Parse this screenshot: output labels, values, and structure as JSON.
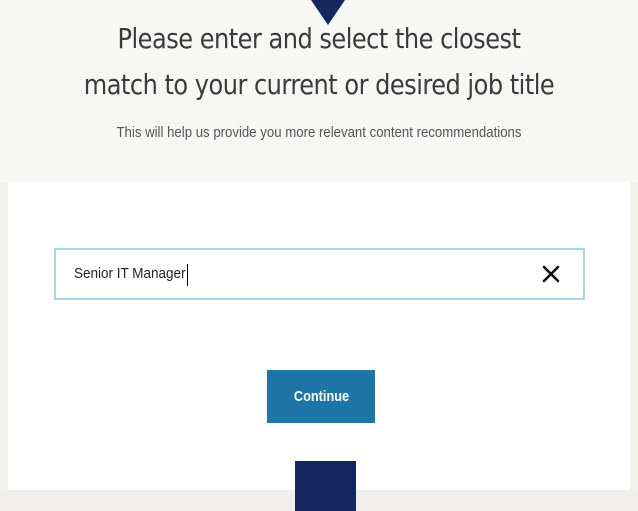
{
  "header": {
    "title": "Please enter and select the closest match to your current or desired job title",
    "subtitle": "This will help us provide you more relevant content recommendations"
  },
  "search": {
    "value": "Senior IT Manager",
    "placeholder": ""
  },
  "clear_icon": "close-icon",
  "continue_label": "Continue",
  "colors": {
    "accent": "#1d75a8",
    "pointer": "#14275e",
    "input_border": "#a9d5e6",
    "page_background": "#f3f2ef"
  }
}
